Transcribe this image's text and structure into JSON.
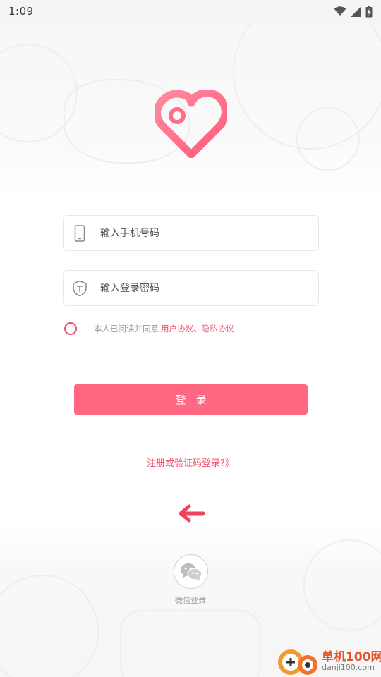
{
  "status_bar": {
    "time": "1:09",
    "icons": [
      "wifi-icon",
      "cellular-signal-icon",
      "battery-icon"
    ]
  },
  "app": {
    "logo_icon": "heart-location-pin-logo",
    "brand_color": "#ff6880",
    "accent_color": "#f0506e"
  },
  "form": {
    "phone": {
      "placeholder": "输入手机号码",
      "value": "",
      "icon": "phone-icon"
    },
    "password": {
      "placeholder": "输入登录密码",
      "value": "",
      "icon": "shield-lock-icon"
    }
  },
  "agreement": {
    "prefix": "本人已阅读并同意",
    "user_agreement": "用户协议",
    "separator": "、",
    "privacy_agreement": "隐私协议",
    "checked": false
  },
  "login_button": {
    "label": "登录"
  },
  "register_link": {
    "label": "注册或验证码登录?》"
  },
  "hint_arrow": {
    "icon": "left-arrow-icon",
    "color": "#f0435e"
  },
  "third_party": {
    "wechat_label": "微信登录",
    "icon": "wechat-icon"
  },
  "watermark": {
    "title": "单机100网",
    "url": "danji100.com"
  }
}
